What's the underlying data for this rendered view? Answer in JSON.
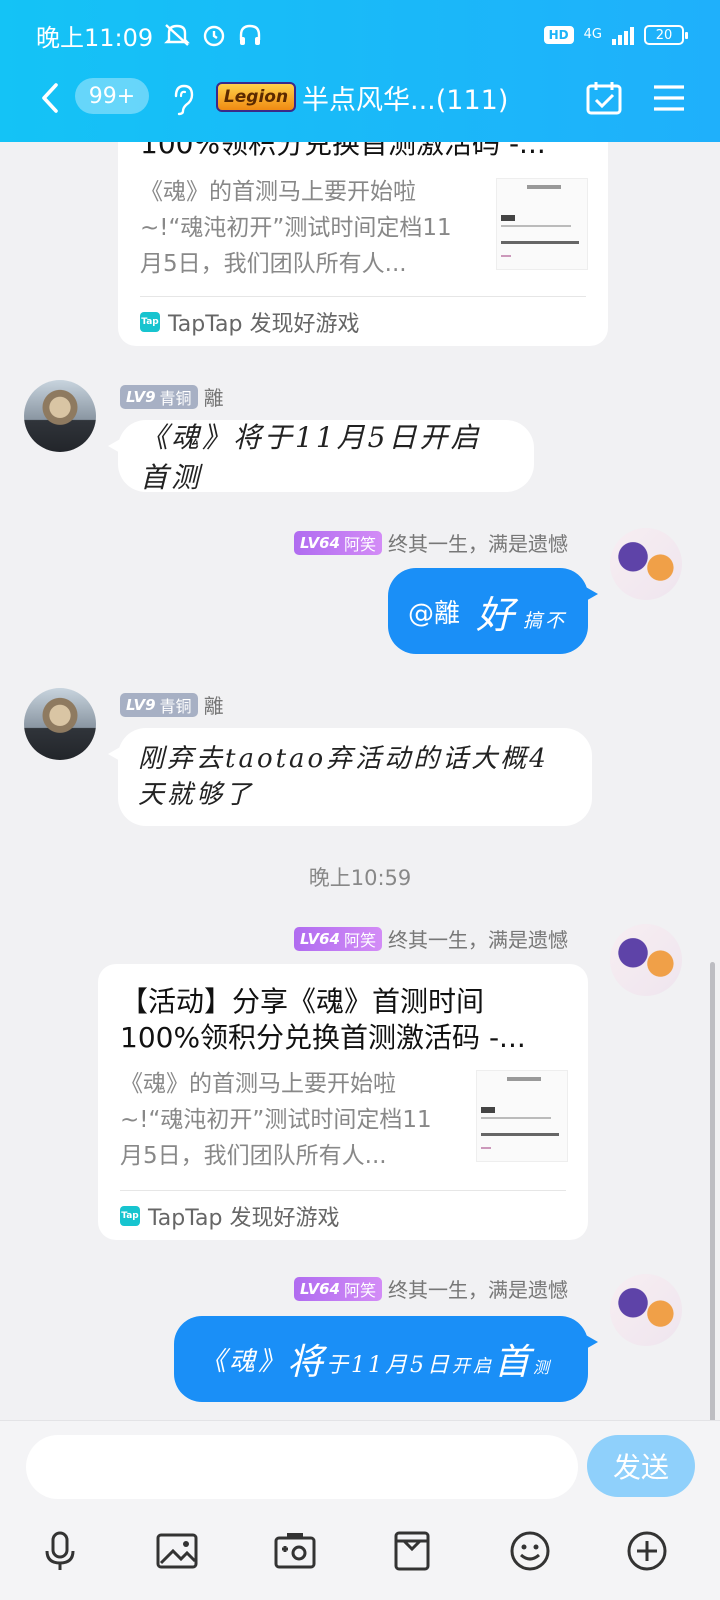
{
  "status_bar": {
    "time": "晚上11:09",
    "hd": "HD",
    "net": "4G",
    "battery": "20"
  },
  "nav": {
    "unread": "99+",
    "group_tag": "Legion",
    "title": "半点风华...(111)"
  },
  "colors": {
    "header": "#1db4f8",
    "out_bubble": "#1a8ff7",
    "send_button": "#8fd0fb"
  },
  "icons": [
    "back-icon",
    "ear-icon",
    "calendar-check-icon",
    "menu-icon",
    "microphone-icon",
    "image-icon",
    "camera-icon",
    "file-icon",
    "emoji-icon",
    "plus-icon"
  ],
  "shared_card": {
    "title": "【活动】分享《魂》首测时间100%领积分兑换首测激活码 -...",
    "title_partial": "100%领积分兑换首测激活码 -...",
    "description": "《魂》的首测马上要开始啦~!“魂沌初开”测试时间定档11月5日，我们团队所有人...",
    "source": "TapTap 发现好游戏",
    "source_icon": "Tap"
  },
  "users": {
    "li": {
      "level": "LV9",
      "rank": "青铜",
      "name": "離"
    },
    "axiao": {
      "level": "LV64",
      "rank": "阿笑",
      "name": "终其一生，满是遗憾"
    }
  },
  "messages": {
    "m1": "《魂》将于11月5日开启首测",
    "m2_at": "@離",
    "m2_big": "好",
    "m2_small": "搞不",
    "m3": "刚弃去taotao弃活动的话大概4天就够了",
    "m5_a": "《魂》",
    "m5_b": "将",
    "m5_c": "于11月5日",
    "m5_d": "开启",
    "m5_e": "首",
    "m5_f": "测"
  },
  "timestamp": "晚上10:59",
  "input": {
    "send_label": "发送"
  }
}
